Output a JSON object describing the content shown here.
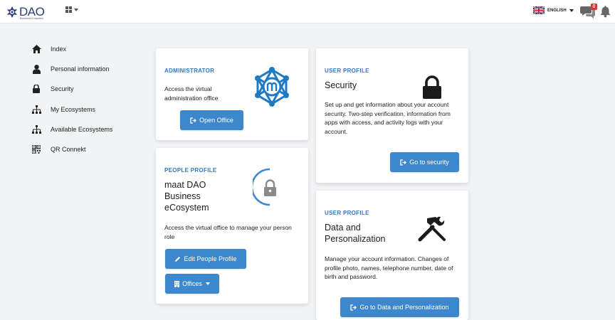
{
  "header": {
    "logo_text": "DAO",
    "logo_subtext": "Business eCosystem",
    "language": "ENGLISH",
    "notifications_count": "0"
  },
  "sidebar": {
    "items": [
      {
        "label": "Index",
        "icon": "home-icon"
      },
      {
        "label": "Personal information",
        "icon": "user-icon"
      },
      {
        "label": "Security",
        "icon": "lock-icon"
      },
      {
        "label": "My Ecosystems",
        "icon": "sitemap-icon"
      },
      {
        "label": "Available Ecosystems",
        "icon": "sitemap-icon"
      },
      {
        "label": "QR Connekt",
        "icon": "qrcode-icon"
      }
    ]
  },
  "cards": {
    "admin": {
      "kicker": "ADMINISTRATOR",
      "desc": "Access the virtual administration office",
      "button": "Open Office",
      "icon": "maat-logo-icon"
    },
    "people": {
      "kicker": "PEOPLE PROFILE",
      "title": "maat DAO Business eCosystem",
      "desc": "Access the virtual office to manage your person role",
      "button": "Edit People Profile",
      "offices_button": "Offices",
      "icon": "lock-progress-icon"
    },
    "security": {
      "kicker": "USER PROFILE",
      "title": "Security",
      "desc": "Set up and get information about your account security. Two-step verification, information from apps with access, and activity logs with your account.",
      "button": "Go to security",
      "icon": "lock-icon"
    },
    "data": {
      "kicker": "USER PROFILE",
      "title": "Data and Personalization",
      "desc": "Manage your account information. Changes of profile photo, names, telephone number, date of birth and password.",
      "button": "Go to Data and Personalization",
      "icon": "tools-icon"
    }
  },
  "colors": {
    "accent": "#3d87cd",
    "kicker": "#3178c6",
    "maat_blue": "#1f7bc1",
    "badge": "#e0312d"
  }
}
